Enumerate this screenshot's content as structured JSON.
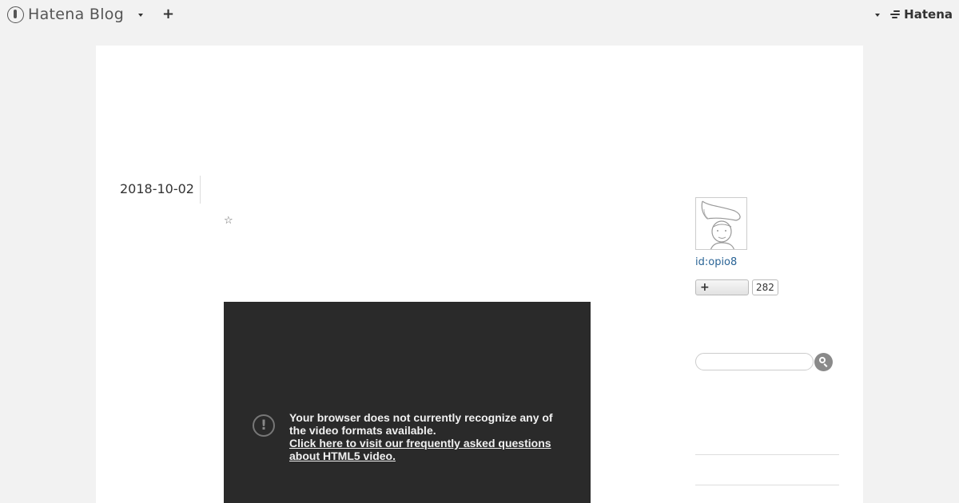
{
  "topbar": {
    "logo_text": "Hatena Blog",
    "brand_text": "Hatena"
  },
  "entry": {
    "date": "2018-10-02",
    "star_glyph": "☆"
  },
  "video": {
    "alert_glyph": "!",
    "message": "Your browser does not currently recognize any of the video formats available.",
    "link_text": "Click here to visit our frequently asked questions about HTML5 video."
  },
  "sidebar": {
    "user_id": "id:opio8",
    "follow_glyph": "+",
    "follower_count": "282",
    "search_placeholder": ""
  }
}
